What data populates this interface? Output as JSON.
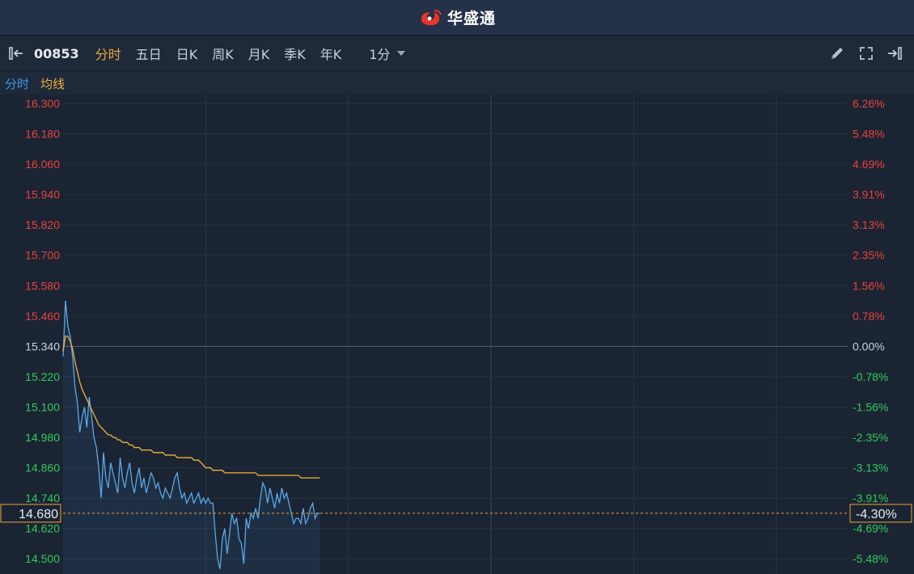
{
  "app": {
    "brand_name": "华盛通"
  },
  "toolbar": {
    "stock_code": "00853",
    "tabs": [
      "分时",
      "五日",
      "日K",
      "周K",
      "月K",
      "季K",
      "年K"
    ],
    "active_tab": 0,
    "interval": "1分"
  },
  "legend": {
    "price_label": "分时",
    "avg_label": "均线"
  },
  "colors": {
    "up": "#e8423b",
    "down": "#2ecc5b",
    "neutral": "#c8d0dc",
    "price_line": "#5aa9e8",
    "avg_line": "#f0b33a",
    "accent": "#f0a53a"
  },
  "chart_data": {
    "type": "line",
    "base_price": 15.34,
    "ylim": [
      14.44,
      16.3
    ],
    "y_ticks": [
      "16.300",
      "16.180",
      "16.060",
      "15.940",
      "15.820",
      "15.700",
      "15.580",
      "15.460",
      "15.340",
      "15.220",
      "15.100",
      "14.980",
      "14.860",
      "14.740",
      "14.620",
      "14.500"
    ],
    "pct_ticks": [
      "6.26%",
      "5.48%",
      "4.69%",
      "3.91%",
      "3.13%",
      "2.35%",
      "1.56%",
      "0.78%",
      "0.00%",
      "-0.78%",
      "-1.56%",
      "-2.35%",
      "-3.13%",
      "-3.91%",
      "-4.69%",
      "-5.48%"
    ],
    "current_price": "14.680",
    "current_pct": "-4.30%",
    "total_minutes": 330,
    "series": [
      {
        "values": [
          15.3,
          15.52,
          15.42,
          15.38,
          15.3,
          15.18,
          15.12,
          15.0,
          15.06,
          15.1,
          15.02,
          15.14,
          15.06,
          14.98,
          14.94,
          14.86,
          14.74,
          14.92,
          14.82,
          14.78,
          14.88,
          14.84,
          14.8,
          14.76,
          14.9,
          14.82,
          14.78,
          14.84,
          14.88,
          14.8,
          14.76,
          14.82,
          14.86,
          14.78,
          14.82,
          14.76,
          14.8,
          14.84,
          14.82,
          14.78,
          14.8,
          14.76,
          14.74,
          14.78,
          14.76,
          14.74,
          14.78,
          14.82,
          14.84,
          14.78,
          14.74,
          14.76,
          14.72,
          14.74,
          14.76,
          14.72,
          14.74,
          14.76,
          14.72,
          14.74,
          14.72,
          14.74,
          14.72,
          14.72,
          14.6,
          14.5,
          14.46,
          14.58,
          14.62,
          14.52,
          14.6,
          14.68,
          14.64,
          14.66,
          14.58,
          14.56,
          14.48,
          14.66,
          14.62,
          14.68,
          14.66,
          14.7,
          14.66,
          14.74,
          14.8,
          14.78,
          14.72,
          14.78,
          14.74,
          14.7,
          14.76,
          14.72,
          14.78,
          14.74,
          14.76,
          14.72,
          14.68,
          14.64,
          14.66,
          14.66,
          14.64,
          14.7,
          14.64,
          14.66,
          14.7,
          14.72,
          14.66,
          14.68,
          14.68
        ]
      },
      {
        "values": [
          15.32,
          15.38,
          15.38,
          15.36,
          15.33,
          15.28,
          15.24,
          15.2,
          15.17,
          15.15,
          15.13,
          15.11,
          15.09,
          15.07,
          15.05,
          15.03,
          15.02,
          15.01,
          15.0,
          14.99,
          14.99,
          14.98,
          14.98,
          14.97,
          14.97,
          14.96,
          14.96,
          14.96,
          14.95,
          14.95,
          14.94,
          14.94,
          14.94,
          14.93,
          14.93,
          14.93,
          14.93,
          14.93,
          14.92,
          14.92,
          14.92,
          14.92,
          14.92,
          14.91,
          14.91,
          14.91,
          14.91,
          14.91,
          14.9,
          14.9,
          14.9,
          14.9,
          14.9,
          14.9,
          14.9,
          14.89,
          14.89,
          14.89,
          14.88,
          14.87,
          14.86,
          14.86,
          14.86,
          14.85,
          14.85,
          14.85,
          14.85,
          14.85,
          14.84,
          14.84,
          14.84,
          14.84,
          14.84,
          14.84,
          14.84,
          14.84,
          14.84,
          14.84,
          14.84,
          14.84,
          14.84,
          14.84,
          14.83,
          14.83,
          14.83,
          14.83,
          14.83,
          14.83,
          14.83,
          14.83,
          14.83,
          14.83,
          14.83,
          14.83,
          14.83,
          14.83,
          14.83,
          14.83,
          14.83,
          14.83,
          14.82,
          14.82,
          14.82,
          14.82,
          14.82,
          14.82,
          14.82,
          14.82,
          14.82
        ]
      }
    ]
  }
}
